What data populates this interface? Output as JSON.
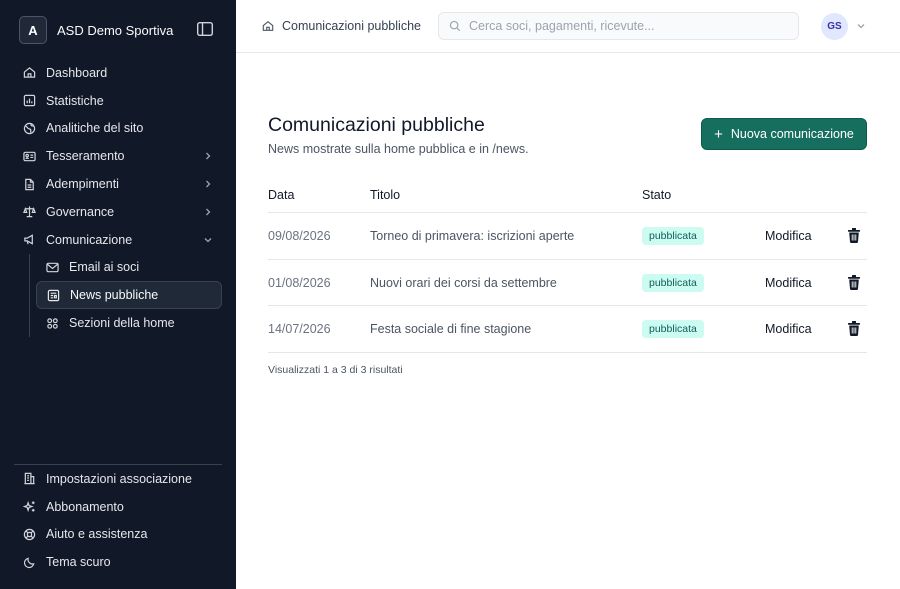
{
  "sidebar": {
    "brand_initial": "A",
    "brand_name": "ASD Demo Sportiva",
    "nav": [
      {
        "label": "Dashboard",
        "icon": "home-icon"
      },
      {
        "label": "Statistiche",
        "icon": "chart-icon"
      },
      {
        "label": "Analitiche del sito",
        "icon": "globe-icon"
      },
      {
        "label": "Tesseramento",
        "icon": "id-card-icon",
        "expandable": true
      },
      {
        "label": "Adempimenti",
        "icon": "document-icon",
        "expandable": true
      },
      {
        "label": "Governance",
        "icon": "scale-icon",
        "expandable": true
      },
      {
        "label": "Comunicazione",
        "icon": "megaphone-icon",
        "expanded": true
      }
    ],
    "subnav": [
      {
        "label": "Email ai soci",
        "icon": "mail-icon"
      },
      {
        "label": "News pubbliche",
        "icon": "newspaper-icon",
        "active": true
      },
      {
        "label": "Sezioni della home",
        "icon": "grid-icon"
      }
    ],
    "bottom": [
      {
        "label": "Impostazioni associazione",
        "icon": "building-icon"
      },
      {
        "label": "Abbonamento",
        "icon": "sparkles-icon"
      },
      {
        "label": "Aiuto e assistenza",
        "icon": "lifebuoy-icon"
      },
      {
        "label": "Tema scuro",
        "icon": "moon-icon"
      }
    ]
  },
  "topbar": {
    "breadcrumb": "Comunicazioni pubbliche",
    "search_placeholder": "Cerca soci, pagamenti, ricevute...",
    "avatar_initials": "GS"
  },
  "main": {
    "title": "Comunicazioni pubbliche",
    "subtitle": "News mostrate sulla home pubblica e in /news.",
    "new_button": "Nuova comunicazione",
    "columns": {
      "date": "Data",
      "title": "Titolo",
      "state": "Stato"
    },
    "rows": [
      {
        "date": "09/08/2026",
        "title": "Torneo di primavera: iscrizioni aperte",
        "state": "pubblicata",
        "edit": "Modifica"
      },
      {
        "date": "01/08/2026",
        "title": "Nuovi orari dei corsi da settembre",
        "state": "pubblicata",
        "edit": "Modifica"
      },
      {
        "date": "14/07/2026",
        "title": "Festa sociale di fine stagione",
        "state": "pubblicata",
        "edit": "Modifica"
      }
    ],
    "results_note": "Visualizzati 1 a 3 di 3 risultati"
  },
  "colors": {
    "sidebar_bg": "#111827",
    "accent": "#166f5e",
    "badge_bg": "#ccfbf1",
    "badge_text": "#115e59"
  }
}
